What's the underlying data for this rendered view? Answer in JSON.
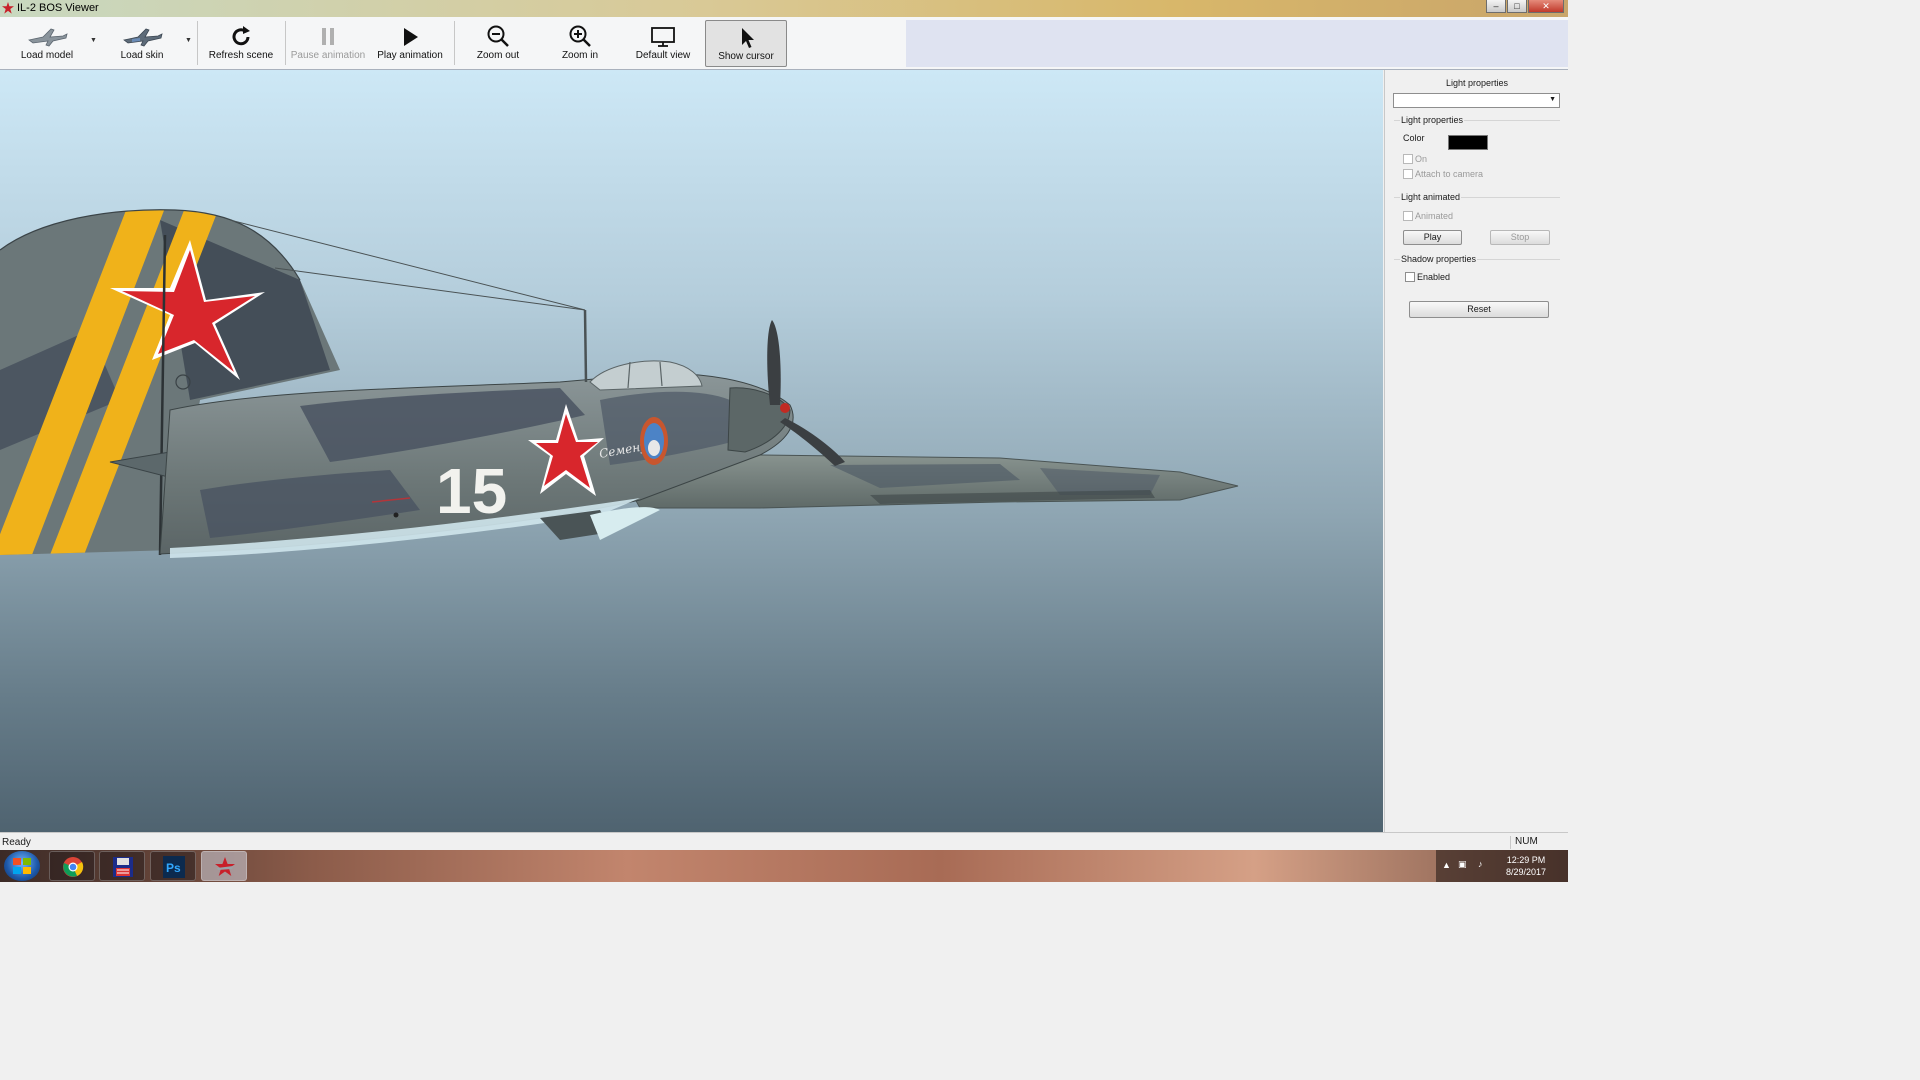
{
  "window": {
    "title": "IL-2 BOS Viewer",
    "icon": "red-star-icon",
    "controls": [
      "minimize",
      "maximize",
      "close"
    ]
  },
  "toolbar": {
    "load_model": "Load model",
    "load_skin": "Load skin",
    "refresh_scene": "Refresh scene",
    "pause_animation": "Pause animation",
    "play_animation": "Play animation",
    "zoom_out": "Zoom out",
    "zoom_in": "Zoom in",
    "default_view": "Default view",
    "show_cursor": "Show cursor"
  },
  "viewport": {
    "aircraft_number": "15",
    "fuselage_script": "Семену"
  },
  "panel": {
    "title": "Light properties",
    "combo_value": "",
    "light_group": {
      "title": "Light properties",
      "color_label": "Color",
      "color_value": "#000000",
      "on_label": "On",
      "on_checked": false,
      "attach_label": "Attach to camera",
      "attach_checked": false
    },
    "animated_group": {
      "title": "Light animated",
      "animated_label": "Animated",
      "animated_checked": false,
      "play_label": "Play",
      "stop_label": "Stop"
    },
    "shadow_group": {
      "title": "Shadow properties",
      "enabled_label": "Enabled",
      "enabled_checked": false
    },
    "reset_label": "Reset"
  },
  "statusbar": {
    "status": "Ready",
    "indicator": "NUM"
  },
  "taskbar": {
    "apps": [
      "chrome-icon",
      "floppy-disk-icon",
      "photoshop-icon",
      "il2-viewer-icon"
    ],
    "photoshop_glyph": "Ps",
    "time": "12:29 PM",
    "date": "8/29/2017"
  },
  "colors": {
    "accent_toolbar_fill": "#dfe3f1",
    "stripe_yellow": "#f0b21a",
    "star_red": "#d8262c"
  }
}
